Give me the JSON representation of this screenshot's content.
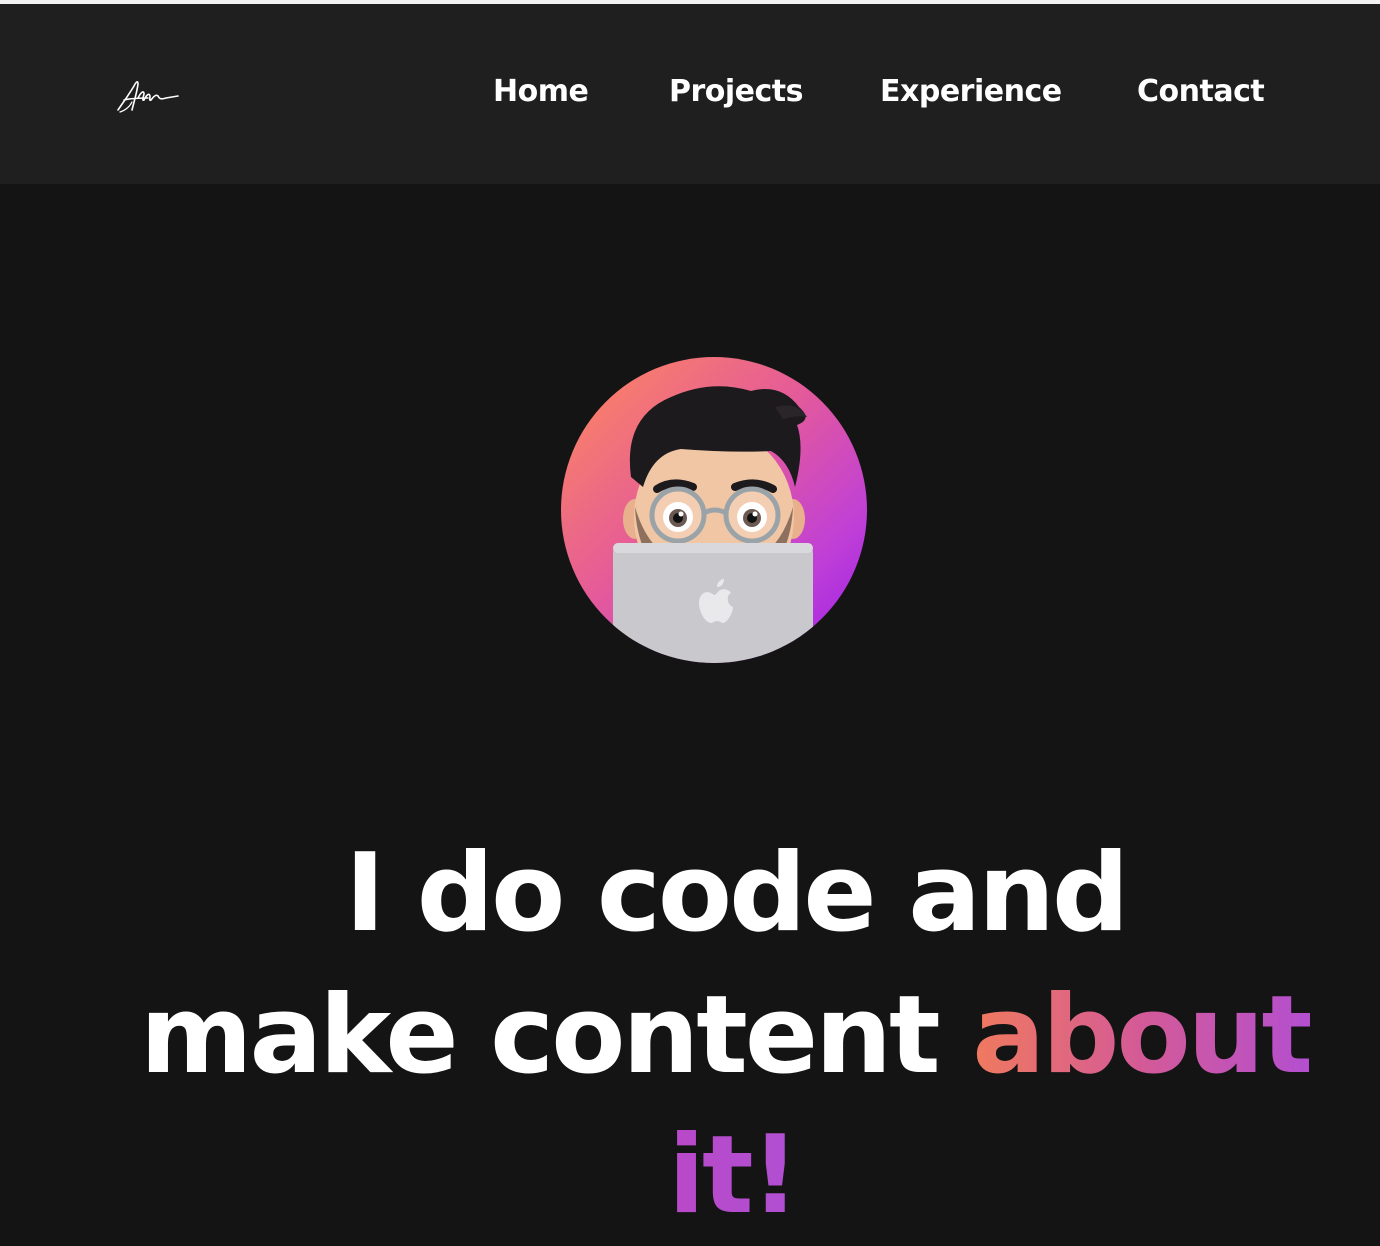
{
  "nav": {
    "logo_icon": "signature-logo",
    "items": [
      {
        "label": "Home"
      },
      {
        "label": "Projects"
      },
      {
        "label": "Experience"
      },
      {
        "label": "Contact"
      }
    ]
  },
  "hero": {
    "avatar_icon": "memoji-laptop-avatar",
    "line1": "I do code and",
    "line2_prefix": "make content ",
    "line2_highlight": "about",
    "line3_highlight": "it!"
  },
  "colors": {
    "navbar_bg": "#1f1f1f",
    "page_bg": "#151414",
    "text": "#ffffff",
    "gradient_start": "#f07a5e",
    "gradient_end": "#b34fd0",
    "avatar_gradient_start": "#ff8a5b",
    "avatar_gradient_end": "#9b1de8"
  }
}
